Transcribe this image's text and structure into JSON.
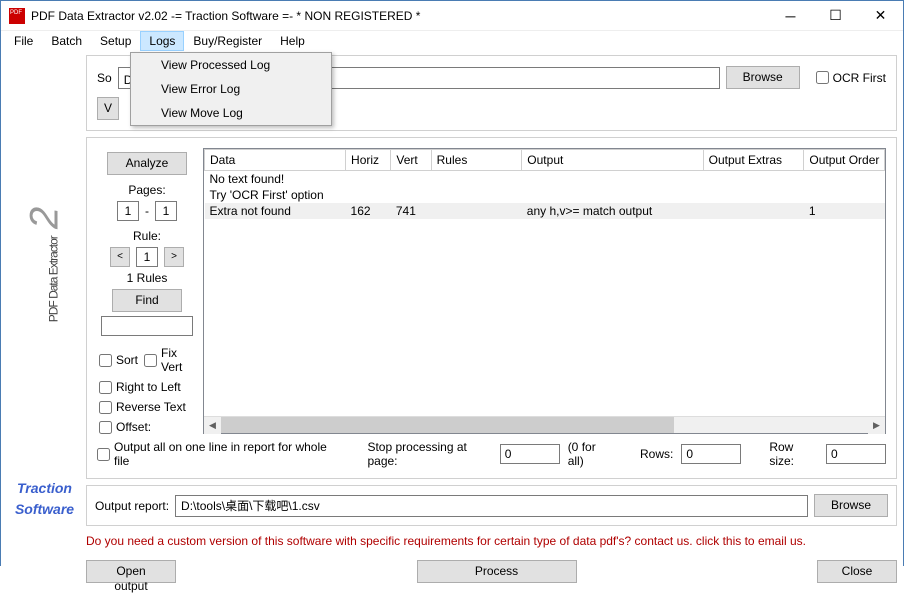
{
  "title": "PDF Data Extractor v2.02   -= Traction Software =- * NON REGISTERED *",
  "menu": {
    "file": "File",
    "batch": "Batch",
    "setup": "Setup",
    "logs": "Logs",
    "buyreg": "Buy/Register",
    "help": "Help"
  },
  "logs_dropdown": {
    "processed": "View Processed Log",
    "error": "View Error Log",
    "move": "View Move Log"
  },
  "sidebar": {
    "product_name": "PDF Data Extractor",
    "version_glyph": "2",
    "company1": "Traction",
    "company2": "Software"
  },
  "top": {
    "source_label": "So",
    "v_label": "V",
    "doc_value": "DOC 文档.pdf",
    "browse": "Browse",
    "ocr_first": "OCR First"
  },
  "left": {
    "analyze": "Analyze",
    "pages": "Pages:",
    "pg_from": "1",
    "pg_to": "1",
    "rule": "Rule:",
    "rule_num": "1",
    "rules_count": "1  Rules",
    "find": "Find",
    "sort": "Sort",
    "fixvert": "Fix Vert",
    "r2l": "Right to Left",
    "reverse": "Reverse Text",
    "offset": "Offset:",
    "output_all": "Output all on one line in report for whole file"
  },
  "table": {
    "cols": {
      "data": "Data",
      "horiz": "Horiz",
      "vert": "Vert",
      "rules": "Rules",
      "output": "Output",
      "extras": "Output Extras",
      "order": "Output Order"
    },
    "r1_data": "No text found!",
    "r2_data": "Try 'OCR First' option",
    "r3_data": "Extra not found",
    "r3_h": "162",
    "r3_v": "741",
    "r3_out": "any h,v>= match output",
    "r3_ord": "1"
  },
  "bottom": {
    "stop_label": "Stop processing at page:",
    "stop_val": "0",
    "forall": "(0 for all)",
    "rows_label": "Rows:",
    "rows_val": "0",
    "rowsize_label": "Row size:",
    "rowsize_val": "0",
    "outreport_label": "Output report:",
    "outreport_val": "D:\\tools\\桌面\\下载吧\\1.csv",
    "browse": "Browse",
    "redtext": "Do you need a custom version of this software with specific requirements for certain type of data pdf's? contact us. click this to email us.",
    "open": "Open output",
    "process": "Process",
    "close": "Close"
  }
}
